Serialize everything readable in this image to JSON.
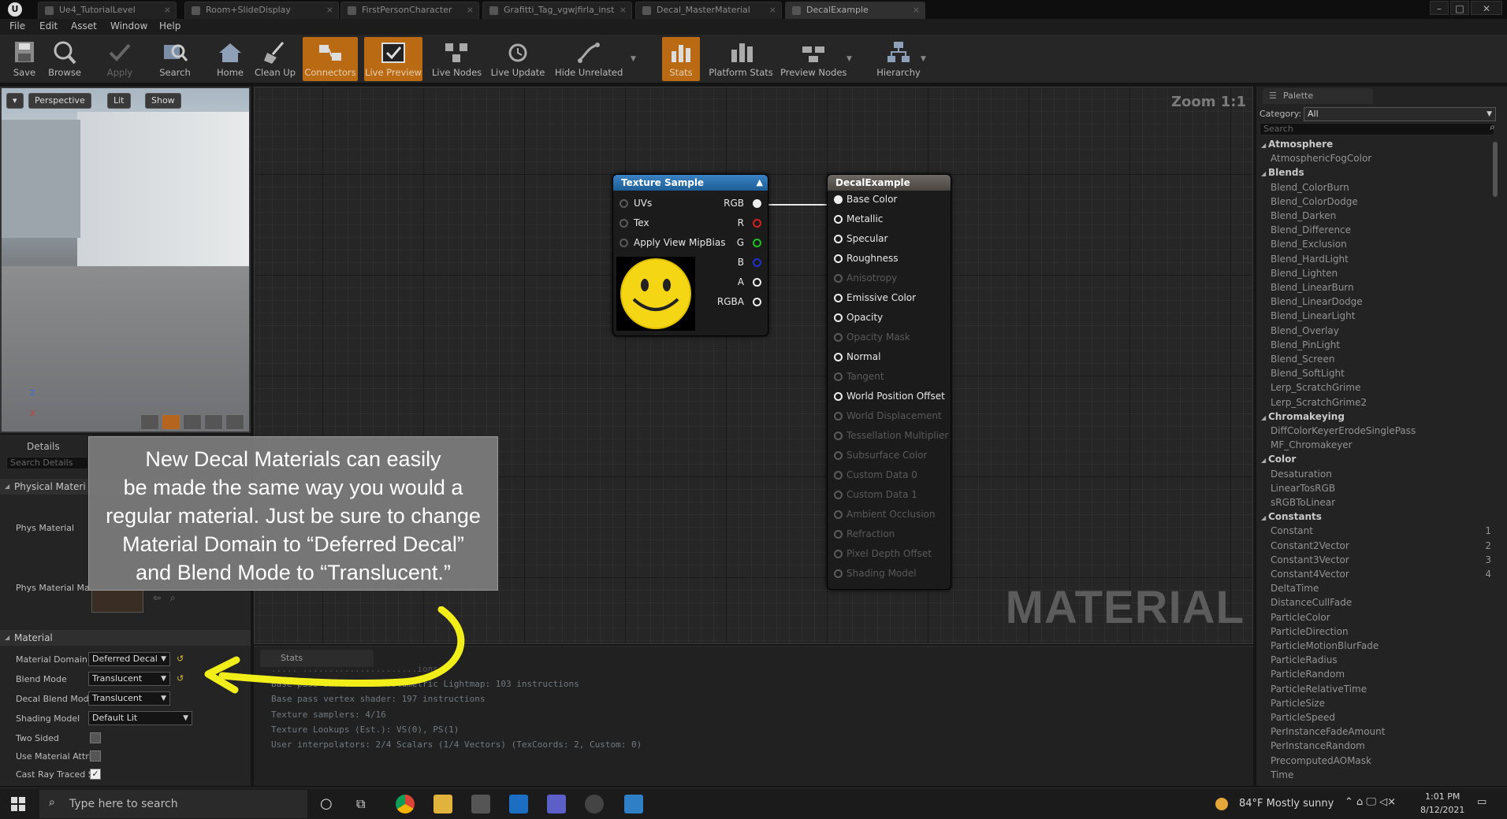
{
  "tabs": [
    "Ue4_TutorialLevel",
    "Room+SlideDisplay",
    "FirstPersonCharacter",
    "Grafitti_Tag_vgwjfirla_inst",
    "Decal_MasterMaterial",
    "DecalExample"
  ],
  "menu": [
    "File",
    "Edit",
    "Asset",
    "Window",
    "Help"
  ],
  "toolbar": {
    "save": "Save",
    "browse": "Browse",
    "apply": "Apply",
    "search": "Search",
    "home": "Home",
    "clean_up": "Clean Up",
    "connectors": "Connectors",
    "live_preview": "Live Preview",
    "live_nodes": "Live Nodes",
    "live_update": "Live Update",
    "hide_unrelated": "Hide Unrelated",
    "stats": "Stats",
    "platform_stats": "Platform Stats",
    "preview_nodes": "Preview Nodes",
    "hierarchy": "Hierarchy"
  },
  "viewport": {
    "perspective": "Perspective",
    "lit": "Lit",
    "show": "Show",
    "axis_z": "Z",
    "axis_x": "X"
  },
  "details": {
    "tab": "Details",
    "search_placeholder": "Search Details",
    "physical_section": "Physical Materi",
    "phys_material": "Phys Material",
    "phys_material_mask": "Phys Material Ma",
    "material_section": "Material",
    "props": [
      {
        "label": "Material Domain",
        "value": "Deferred Decal"
      },
      {
        "label": "Blend Mode",
        "value": "Translucent"
      },
      {
        "label": "Decal Blend Mode",
        "value": "Translucent"
      },
      {
        "label": "Shading Model",
        "value": "Default Lit"
      },
      {
        "label": "Two Sided",
        "value": ""
      },
      {
        "label": "Use Material Attri",
        "value": ""
      },
      {
        "label": "Cast Ray Traced S",
        "value": ""
      }
    ]
  },
  "graph": {
    "zoom": "Zoom 1:1",
    "watermark": "MATERIAL",
    "texture_node": {
      "title": "Texture Sample",
      "inputs": [
        "UVs",
        "Tex",
        "Apply View MipBias"
      ],
      "outputs": [
        "RGB",
        "R",
        "G",
        "B",
        "A",
        "RGBA"
      ]
    },
    "result_node": {
      "title": "DecalExample",
      "pins": [
        {
          "label": "Base Color",
          "active": true
        },
        {
          "label": "Metallic",
          "active": true
        },
        {
          "label": "Specular",
          "active": true
        },
        {
          "label": "Roughness",
          "active": true
        },
        {
          "label": "Anisotropy",
          "active": false
        },
        {
          "label": "Emissive Color",
          "active": true
        },
        {
          "label": "Opacity",
          "active": true
        },
        {
          "label": "Opacity Mask",
          "active": false
        },
        {
          "label": "Normal",
          "active": true
        },
        {
          "label": "Tangent",
          "active": false
        },
        {
          "label": "World Position Offset",
          "active": true
        },
        {
          "label": "World Displacement",
          "active": false
        },
        {
          "label": "Tessellation Multiplier",
          "active": false
        },
        {
          "label": "Subsurface Color",
          "active": false
        },
        {
          "label": "Custom Data 0",
          "active": false
        },
        {
          "label": "Custom Data 1",
          "active": false
        },
        {
          "label": "Ambient Occlusion",
          "active": false
        },
        {
          "label": "Refraction",
          "active": false
        },
        {
          "label": "Pixel Depth Offset",
          "active": false
        },
        {
          "label": "Shading Model",
          "active": false
        }
      ]
    }
  },
  "stats": {
    "tab": "Stats",
    "lines": [
      "Base pass shader with Volumetric Lightmap: 103 instructions",
      "Base pass vertex shader: 197 instructions",
      "Texture samplers: 4/16",
      "Texture Lookups (Est.): VS(0), PS(1)",
      "User interpolators: 2/4 Scalars (1/4 Vectors) (TexCoords: 2, Custom: 0)"
    ]
  },
  "palette": {
    "tab": "Palette",
    "category_label": "Category:",
    "category_value": "All",
    "search_placeholder": "Search",
    "entries": [
      {
        "type": "cat",
        "text": "Atmosphere"
      },
      {
        "type": "item",
        "text": "AtmosphericFogColor"
      },
      {
        "type": "cat",
        "text": "Blends"
      },
      {
        "type": "item",
        "text": "Blend_ColorBurn"
      },
      {
        "type": "item",
        "text": "Blend_ColorDodge"
      },
      {
        "type": "item",
        "text": "Blend_Darken"
      },
      {
        "type": "item",
        "text": "Blend_Difference"
      },
      {
        "type": "item",
        "text": "Blend_Exclusion"
      },
      {
        "type": "item",
        "text": "Blend_HardLight"
      },
      {
        "type": "item",
        "text": "Blend_Lighten"
      },
      {
        "type": "item",
        "text": "Blend_LinearBurn"
      },
      {
        "type": "item",
        "text": "Blend_LinearDodge"
      },
      {
        "type": "item",
        "text": "Blend_LinearLight"
      },
      {
        "type": "item",
        "text": "Blend_Overlay"
      },
      {
        "type": "item",
        "text": "Blend_PinLight"
      },
      {
        "type": "item",
        "text": "Blend_Screen"
      },
      {
        "type": "item",
        "text": "Blend_SoftLight"
      },
      {
        "type": "item",
        "text": "Lerp_ScratchGrime"
      },
      {
        "type": "item",
        "text": "Lerp_ScratchGrime2"
      },
      {
        "type": "cat",
        "text": "Chromakeying"
      },
      {
        "type": "item",
        "text": "DiffColorKeyerErodeSinglePass"
      },
      {
        "type": "item",
        "text": "MF_Chromakeyer"
      },
      {
        "type": "cat",
        "text": "Color"
      },
      {
        "type": "item",
        "text": "Desaturation"
      },
      {
        "type": "item",
        "text": "LinearTosRGB"
      },
      {
        "type": "item",
        "text": "sRGBToLinear"
      },
      {
        "type": "cat",
        "text": "Constants"
      },
      {
        "type": "item",
        "text": "Constant",
        "num": "1"
      },
      {
        "type": "item",
        "text": "Constant2Vector",
        "num": "2"
      },
      {
        "type": "item",
        "text": "Constant3Vector",
        "num": "3"
      },
      {
        "type": "item",
        "text": "Constant4Vector",
        "num": "4"
      },
      {
        "type": "item",
        "text": "DeltaTime"
      },
      {
        "type": "item",
        "text": "DistanceCullFade"
      },
      {
        "type": "item",
        "text": "ParticleColor"
      },
      {
        "type": "item",
        "text": "ParticleDirection"
      },
      {
        "type": "item",
        "text": "ParticleMotionBlurFade"
      },
      {
        "type": "item",
        "text": "ParticleRadius"
      },
      {
        "type": "item",
        "text": "ParticleRandom"
      },
      {
        "type": "item",
        "text": "ParticleRelativeTime"
      },
      {
        "type": "item",
        "text": "ParticleSize"
      },
      {
        "type": "item",
        "text": "ParticleSpeed"
      },
      {
        "type": "item",
        "text": "PerInstanceFadeAmount"
      },
      {
        "type": "item",
        "text": "PerInstanceRandom"
      },
      {
        "type": "item",
        "text": "PrecomputedAOMask"
      },
      {
        "type": "item",
        "text": "Time"
      }
    ]
  },
  "callout": {
    "lines": [
      "New Decal Materials can easily",
      "be made the same way you would a",
      "regular material. Just be sure to change",
      "Material Domain to “Deferred Decal”",
      "and Blend Mode to “Translucent.”"
    ]
  },
  "taskbar": {
    "search_placeholder": "Type here to search",
    "weather": "84°F  Mostly sunny",
    "time": "1:01 PM",
    "date": "8/12/2021"
  },
  "colors": {
    "accent_orange": "#b96a13",
    "texture_node_header": "#2a6ea8",
    "result_node_header": "#5a5550",
    "annotation_arrow": "#f2ee1a"
  }
}
